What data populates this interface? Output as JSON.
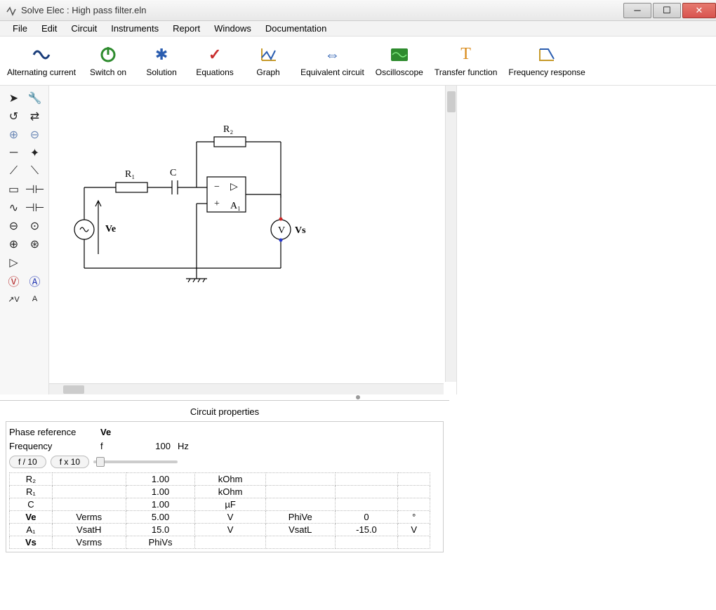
{
  "window": {
    "title": "Solve Elec : High pass filter.eln"
  },
  "menu": [
    "File",
    "Edit",
    "Circuit",
    "Instruments",
    "Report",
    "Windows",
    "Documentation"
  ],
  "toolbar": [
    {
      "label": "Alternating current",
      "icon": "ac-icon"
    },
    {
      "label": "Switch on",
      "icon": "power-icon"
    },
    {
      "label": "Solution",
      "icon": "solution-icon"
    },
    {
      "label": "Equations",
      "icon": "check-icon"
    },
    {
      "label": "Graph",
      "icon": "graph-icon"
    },
    {
      "label": "Equivalent circuit",
      "icon": "equiv-icon"
    },
    {
      "label": "Oscilloscope",
      "icon": "scope-icon"
    },
    {
      "label": "Transfer function",
      "icon": "transfer-icon"
    },
    {
      "label": "Frequency response",
      "icon": "freqresp-icon"
    }
  ],
  "circuit": {
    "components": {
      "R1": "R₁",
      "R2": "R₂",
      "C": "C",
      "A1": "A₁",
      "Ve": "Ve",
      "Vs": "Vs",
      "V": "V"
    }
  },
  "props": {
    "title": "Circuit properties",
    "phase_ref_label": "Phase reference",
    "phase_ref_value": "Ve",
    "freq_label": "Frequency",
    "freq_symbol": "f",
    "freq_value": "100",
    "freq_unit": "Hz",
    "btn_div": "f / 10",
    "btn_mul": "f x 10",
    "rows": [
      {
        "name": "R₂",
        "p1": "",
        "v1": "1.00",
        "u1": "kOhm",
        "p2": "",
        "v2": "",
        "u2": ""
      },
      {
        "name": "R₁",
        "p1": "",
        "v1": "1.00",
        "u1": "kOhm",
        "p2": "",
        "v2": "",
        "u2": ""
      },
      {
        "name": "C",
        "p1": "",
        "v1": "1.00",
        "u1": "µF",
        "p2": "",
        "v2": "",
        "u2": ""
      },
      {
        "name": "Ve",
        "p1": "Verms",
        "v1": "5.00",
        "u1": "V",
        "p2": "PhiVe",
        "v2": "0",
        "u2": "°",
        "bold": true
      },
      {
        "name": "A₁",
        "p1": "VsatH",
        "v1": "15.0",
        "u1": "V",
        "p2": "VsatL",
        "v2": "-15.0",
        "u2": "V"
      },
      {
        "name": "Vs",
        "p1": "Vsrms",
        "v1": "PhiVs",
        "u1": "",
        "p2": "",
        "v2": "",
        "u2": "",
        "bold": true
      }
    ]
  }
}
